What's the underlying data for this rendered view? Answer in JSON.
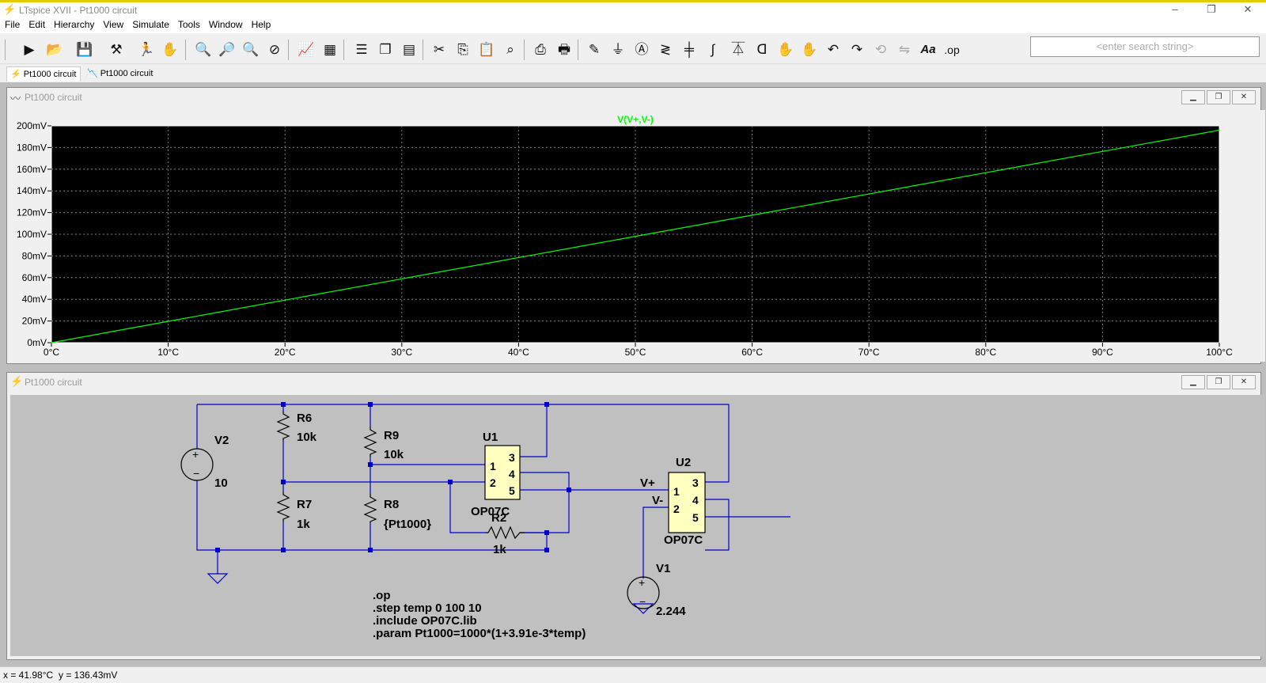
{
  "window": {
    "title": "LTspice XVII - Pt1000 circuit",
    "buttons": [
      "–",
      "❐",
      "✕"
    ]
  },
  "menu": [
    "File",
    "Edit",
    "Hierarchy",
    "View",
    "Simulate",
    "Tools",
    "Window",
    "Help"
  ],
  "toolbar": {
    "icons": [
      "run-icon",
      "open-icon",
      "save-icon",
      "control-panel-icon",
      "halt-icon",
      "pan-hand-icon",
      "zoom-in-icon",
      "zoom-pan-icon",
      "zoom-out-icon",
      "zoom-fit-icon",
      "autorange-icon",
      "grid-icon",
      "tile-horizontal-icon",
      "cascade-icon",
      "tile-vertical-icon",
      "cut-icon",
      "copy-icon",
      "paste-icon",
      "find-icon",
      "print-icon",
      "print-setup-icon",
      "wire-icon",
      "ground-icon",
      "label-net-icon",
      "resistor-icon",
      "capacitor-icon",
      "inductor-icon",
      "diode-icon",
      "component-icon",
      "move-icon",
      "drag-icon",
      "undo-icon",
      "redo-icon",
      "rotate-icon",
      "mirror-icon",
      "text-icon",
      "spice-directive-icon"
    ],
    "spice_directive_label": ".op",
    "text_label": "Aa",
    "search_placeholder": "<enter search string>"
  },
  "tabs": [
    {
      "label": "Pt1000 circuit",
      "active": true
    },
    {
      "label": "Pt1000 circuit",
      "active": false
    }
  ],
  "plot_panel": {
    "title": "Pt1000 circuit",
    "trace_label": "V(V+,V-)",
    "trace_color": "#00ff00"
  },
  "chart_data": {
    "type": "line",
    "title": "V(V+,V-)",
    "xlabel": "",
    "ylabel": "",
    "x": [
      0,
      10,
      20,
      30,
      40,
      50,
      60,
      70,
      80,
      90,
      100
    ],
    "x_tick_labels": [
      "0°C",
      "10°C",
      "20°C",
      "30°C",
      "40°C",
      "50°C",
      "60°C",
      "70°C",
      "80°C",
      "90°C",
      "100°C"
    ],
    "y_tick_labels": [
      "0mV",
      "20mV",
      "40mV",
      "60mV",
      "80mV",
      "100mV",
      "120mV",
      "140mV",
      "160mV",
      "180mV",
      "200mV"
    ],
    "y_ticks": [
      0,
      20,
      40,
      60,
      80,
      100,
      120,
      140,
      160,
      180,
      200
    ],
    "series": [
      {
        "values": [
          0,
          19.7,
          39.3,
          58.9,
          78.5,
          98.1,
          117.6,
          137.2,
          156.8,
          176.4,
          196.0
        ]
      }
    ],
    "xlim": [
      0,
      100
    ],
    "ylim": [
      0,
      200
    ],
    "grid": true,
    "background": "#000000"
  },
  "schematic_panel": {
    "title": "Pt1000 circuit",
    "components": {
      "V2": {
        "name": "V2",
        "value": "10"
      },
      "V1": {
        "name": "V1",
        "value": "2.244"
      },
      "R6": {
        "name": "R6",
        "value": "10k"
      },
      "R7": {
        "name": "R7",
        "value": "1k"
      },
      "R9": {
        "name": "R9",
        "value": "10k"
      },
      "R8": {
        "name": "R8",
        "value": "{Pt1000}"
      },
      "R2": {
        "name": "R2",
        "value": "1k"
      },
      "U1": {
        "name": "U1",
        "model": "OP07C",
        "pins": [
          "1",
          "2",
          "3",
          "4",
          "5"
        ]
      },
      "U2": {
        "name": "U2",
        "model": "OP07C",
        "pins": [
          "1",
          "2",
          "3",
          "4",
          "5"
        ]
      }
    },
    "net_labels": {
      "vplus": "V+",
      "vminus": "V-"
    },
    "directives": [
      ".op",
      ".step temp 0 100 10",
      ".include OP07C.lib",
      ".param Pt1000=1000*(1+3.91e-3*temp)"
    ]
  },
  "status": {
    "x_readout": "x = 41.98°C",
    "y_readout": "y = 136.43mV"
  }
}
